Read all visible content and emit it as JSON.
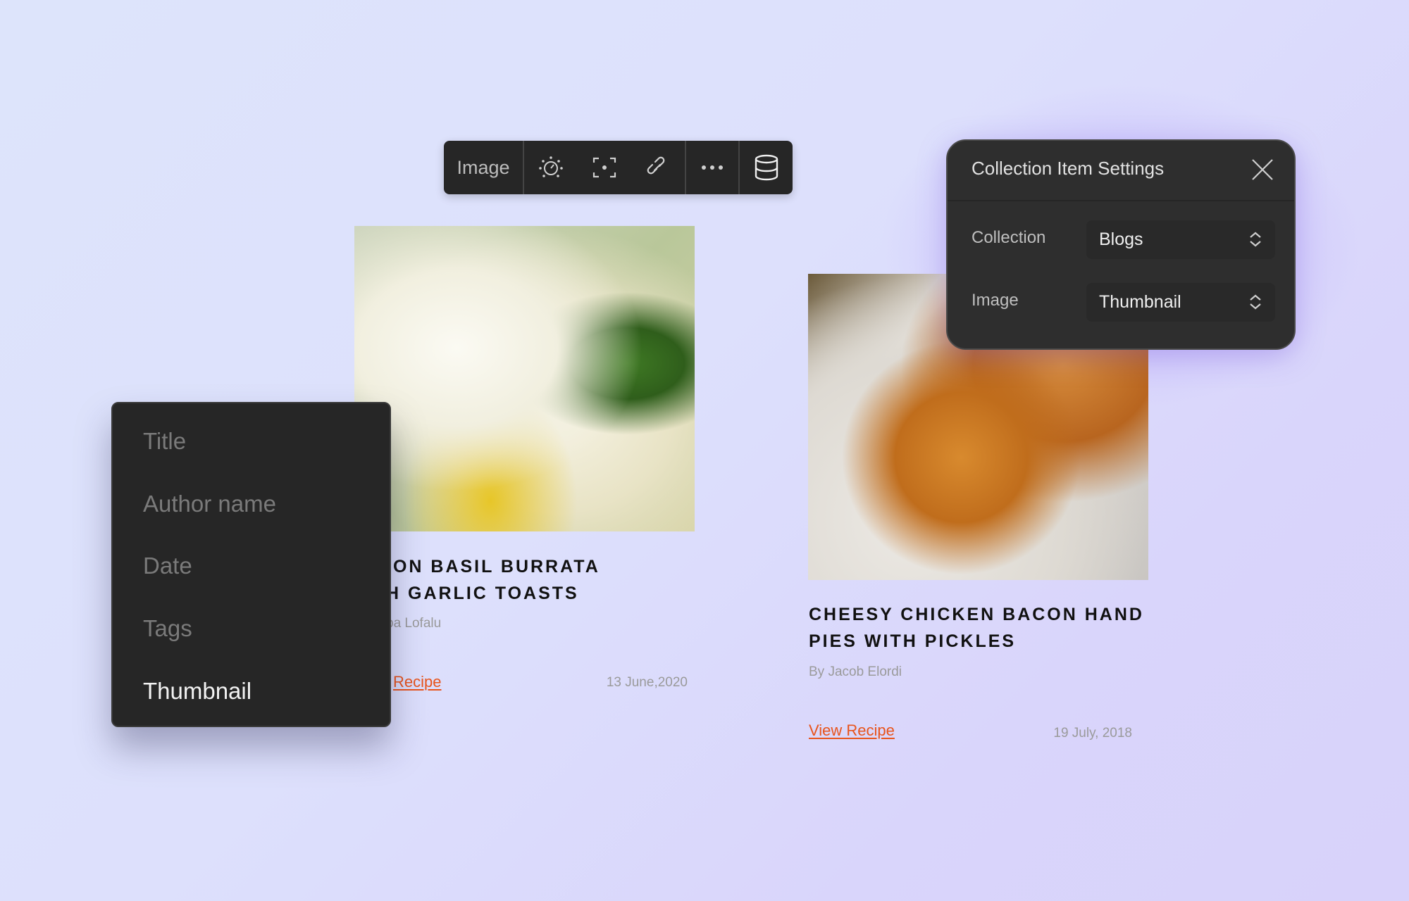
{
  "toolbar": {
    "label": "Image",
    "icons": [
      "brightness-dial-icon",
      "focus-point-icon",
      "link-icon",
      "more-icon",
      "database-icon"
    ]
  },
  "cards": [
    {
      "title_lines": [
        "ION BASIL BURRATA",
        "H GARLIC TOASTS"
      ],
      "author": "ba Lofalu",
      "link": "Recipe",
      "date": "13 June,2020"
    },
    {
      "title_lines": [
        "CHEESY CHICKEN BACON HAND",
        "PIES WITH PICKLES"
      ],
      "author": "By Jacob Elordi",
      "link": "View Recipe",
      "date": "19 July, 2018"
    }
  ],
  "dropdown": {
    "items": [
      "Title",
      "Author name",
      "Date",
      "Tags",
      "Thumbnail"
    ],
    "selected": "Thumbnail"
  },
  "settings": {
    "title": "Collection Item Settings",
    "rows": [
      {
        "label": "Collection",
        "value": "Blogs"
      },
      {
        "label": "Image",
        "value": "Thumbnail"
      }
    ]
  },
  "colors": {
    "accent": "#e8541c",
    "panel": "#2e2e2e",
    "menu": "#262626"
  }
}
